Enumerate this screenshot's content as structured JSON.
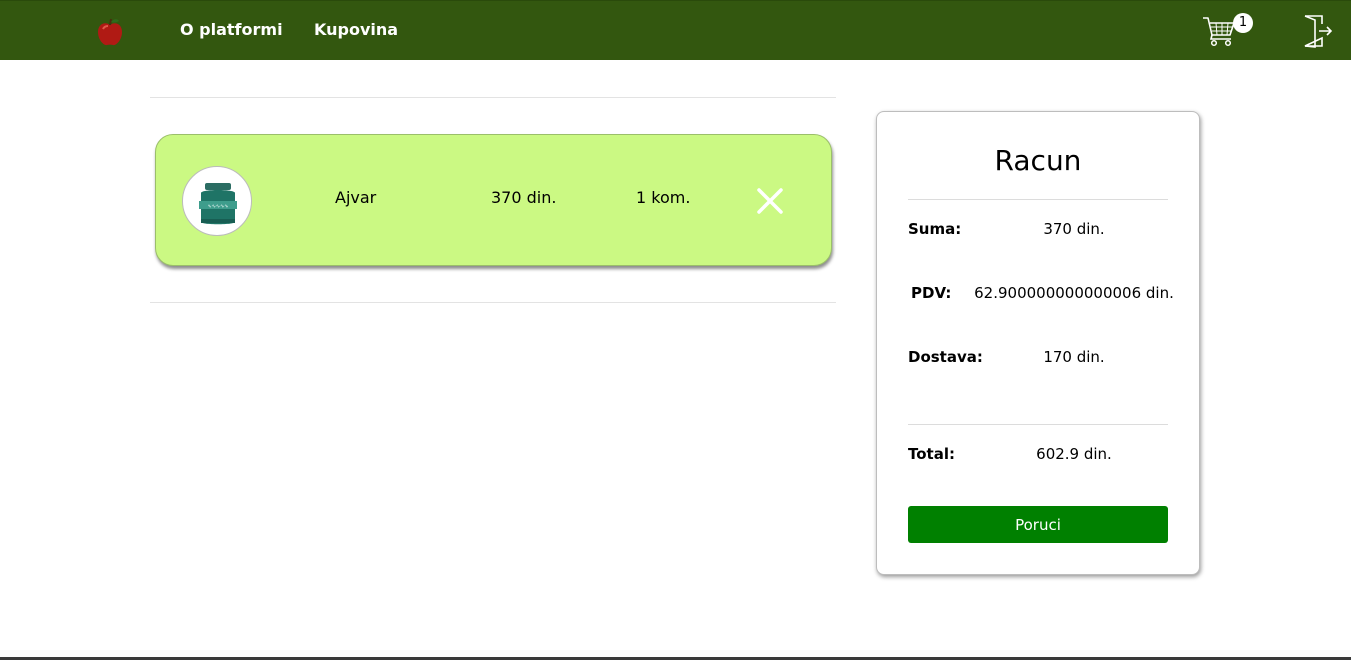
{
  "nav": {
    "about_label": "O platformi",
    "shop_label": "Kupovina",
    "cart_count": "1"
  },
  "cart": {
    "items": [
      {
        "name": "Ajvar",
        "price": "370 din.",
        "quantity": "1 kom.",
        "image_icon": "jar-icon"
      }
    ]
  },
  "bill": {
    "title": "Racun",
    "sum_label": "Suma:",
    "sum_value": "370 din.",
    "vat_label": "PDV:",
    "vat_value": "62.900000000000006 din.",
    "delivery_label": "Dostava:",
    "delivery_value": "170 din.",
    "total_label": "Total:",
    "total_value": "602.9 din.",
    "order_button": "Poruci"
  },
  "colors": {
    "navbar": "#33570f",
    "item_card": "#cbf983",
    "order_button": "#008000"
  }
}
